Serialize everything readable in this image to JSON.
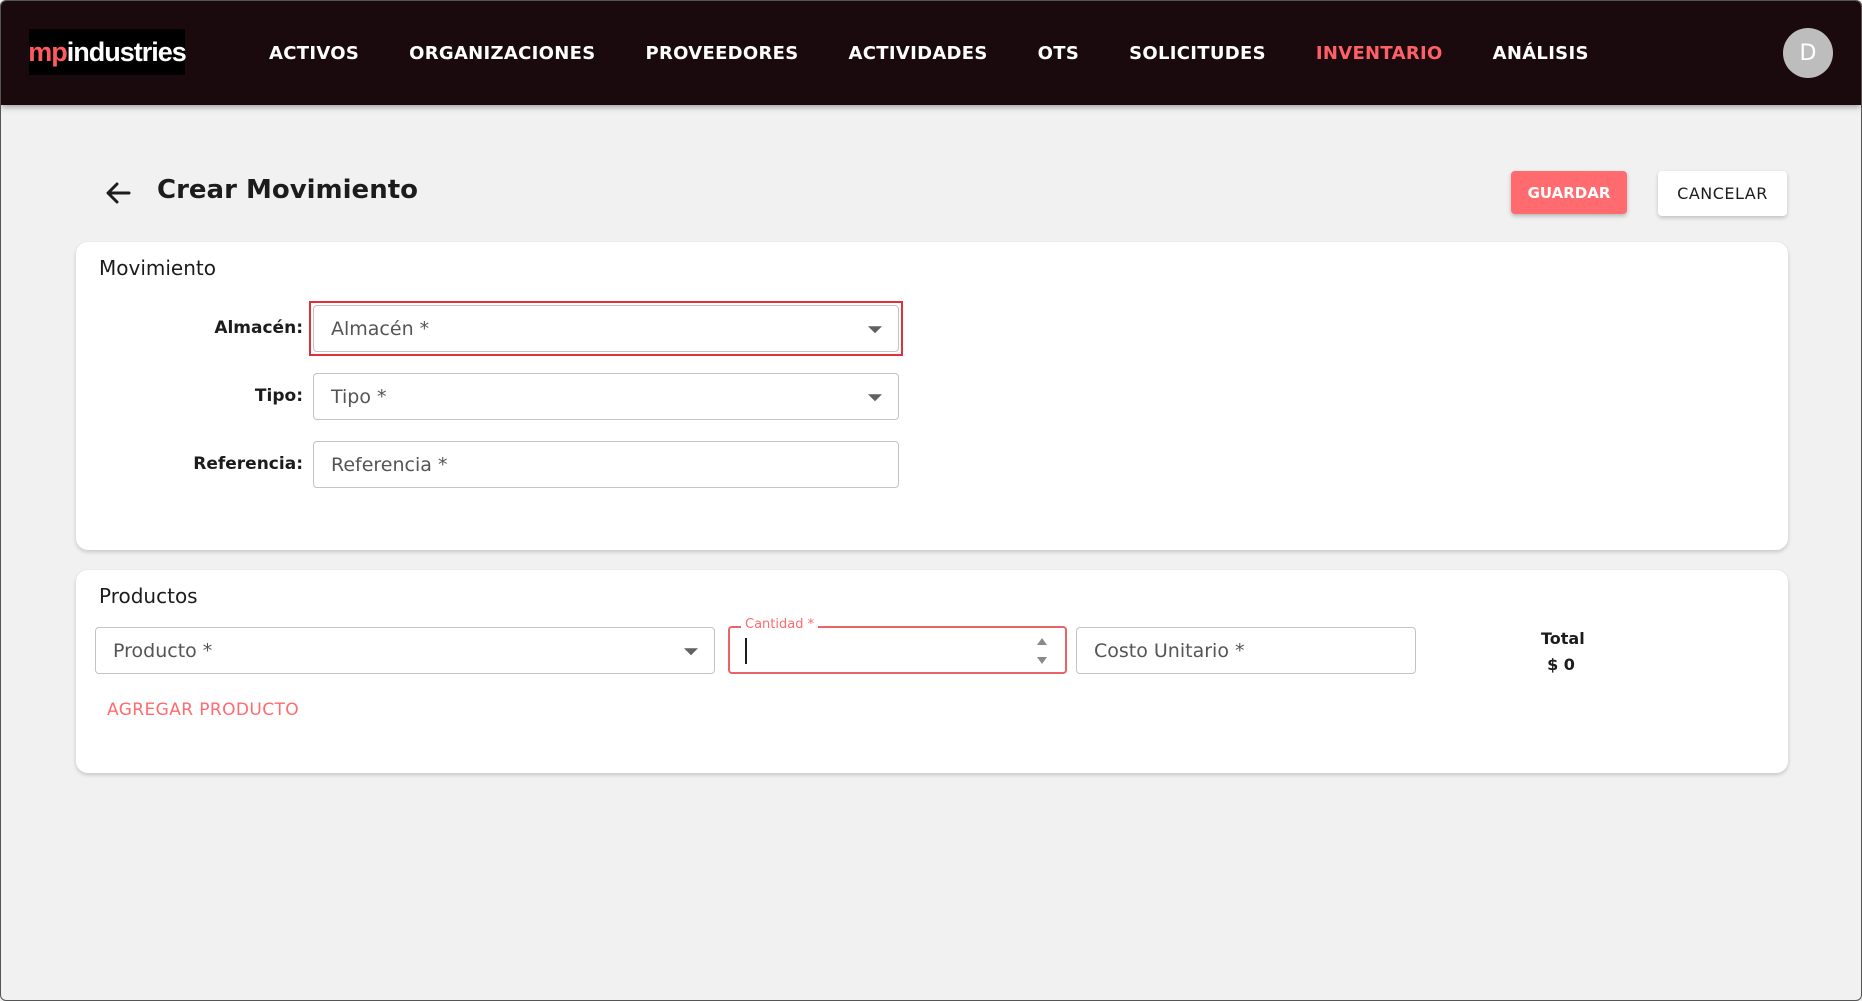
{
  "app": {
    "logo_part1": "mp",
    "logo_part2": "industries",
    "avatar_initial": "D"
  },
  "nav": {
    "items": [
      {
        "label": "ACTIVOS",
        "active": false
      },
      {
        "label": "ORGANIZACIONES",
        "active": false
      },
      {
        "label": "PROVEEDORES",
        "active": false
      },
      {
        "label": "ACTIVIDADES",
        "active": false
      },
      {
        "label": "OTS",
        "active": false
      },
      {
        "label": "SOLICITUDES",
        "active": false
      },
      {
        "label": "INVENTARIO",
        "active": true
      },
      {
        "label": "ANÁLISIS",
        "active": false
      }
    ]
  },
  "header": {
    "title": "Crear Movimiento",
    "save_label": "GUARDAR",
    "cancel_label": "CANCELAR"
  },
  "movimiento": {
    "section_title": "Movimiento",
    "almacen": {
      "label": "Almacén:",
      "placeholder": "Almacén *"
    },
    "tipo": {
      "label": "Tipo:",
      "placeholder": "Tipo *"
    },
    "referencia": {
      "label": "Referencia:",
      "placeholder": "Referencia *"
    }
  },
  "productos": {
    "section_title": "Productos",
    "producto_placeholder": "Producto *",
    "cantidad_label": "Cantidad *",
    "cantidad_value": "",
    "costo_placeholder": "Costo Unitario *",
    "total_label": "Total",
    "total_value": "$ 0",
    "add_label": "AGREGAR PRODUCTO"
  },
  "colors": {
    "navbar_bg": "#1a0a0e",
    "accent": "#ff6b6e",
    "error": "#e0303a",
    "page_bg": "#f1f1f1"
  }
}
